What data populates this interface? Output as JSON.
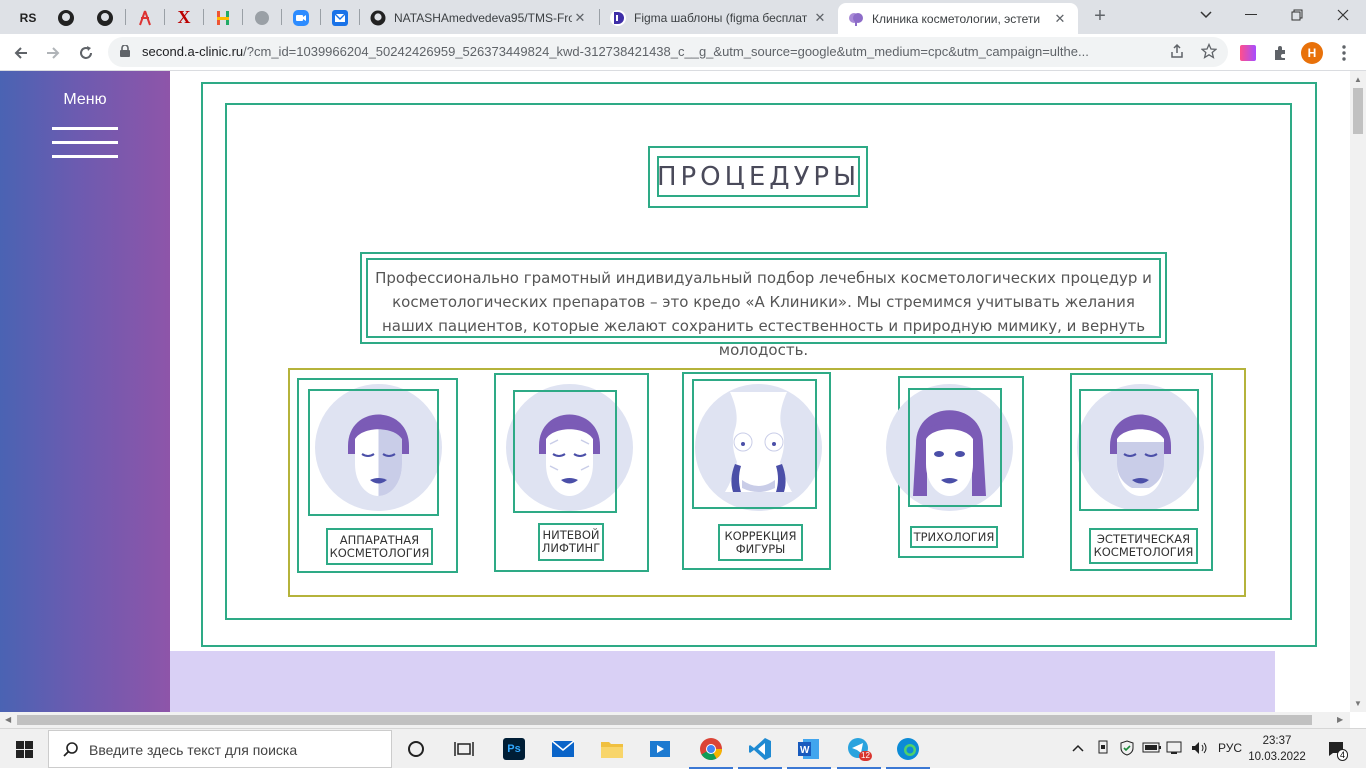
{
  "browser": {
    "pinned_tabs": [
      "RS",
      "github",
      "github",
      "ex",
      "X",
      "H",
      "globe",
      "zoom",
      "mail"
    ],
    "tabs": [
      {
        "title": "NATASHAmedvedeva95/TMS-Fro",
        "icon": "github-icon"
      },
      {
        "title": "Figma шаблоны (figma бесплат",
        "icon": "figma-d-icon"
      },
      {
        "title": "Клиника косметологии, эстети",
        "icon": "brain-icon",
        "active": true
      }
    ],
    "url_host": "second.a-clinic.ru",
    "url_rest": "/?cm_id=1039966204_50242426959_526373449824_kwd-312738421438_c__g_&utm_source=google&utm_medium=cpc&utm_campaign=ulthe...",
    "profile_initial": "H"
  },
  "sidebar": {
    "menu_label": "Меню"
  },
  "section": {
    "title": "ПРОЦЕДУРЫ",
    "description": "Профессионально грамотный индивидуальный подбор лечебных косметологических процедур и косметологических препаратов – это кредо «А Клиники». Мы стремимся учитывать желания наших пациентов, которые желают сохранить естественность и природную мимику, и вернуть молодость.",
    "procedures": [
      {
        "label_line1": "АППАРАТНАЯ",
        "label_line2": "КОСМЕТОЛОГИЯ",
        "icon": "hardware-cosmetology-face-icon"
      },
      {
        "label_line1": "НИТЕВОЙ",
        "label_line2": "ЛИФТИНГ",
        "icon": "thread-lifting-face-icon"
      },
      {
        "label_line1": "КОРРЕКЦИЯ",
        "label_line2": "ФИГУРЫ",
        "icon": "body-contouring-icon"
      },
      {
        "label_line1": "ТРИХОЛОГИЯ",
        "label_line2": "",
        "icon": "trichology-face-icon"
      },
      {
        "label_line1": "ЭСТЕТИЧЕСКАЯ",
        "label_line2": "КОСМЕТОЛОГИЯ",
        "icon": "aesthetic-cosmetology-face-icon"
      }
    ]
  },
  "colors": {
    "outline_green": "#2eaa86",
    "outline_olive": "#b5b33b",
    "hair_purple": "#7b5bb6",
    "lips_indigo": "#4b4fa8",
    "circle_bg": "#dfe3f2",
    "sidebar_from": "#4a63b3",
    "sidebar_to": "#8e55a9",
    "bottom_band": "#d9d0f5"
  },
  "taskbar": {
    "search_placeholder": "Введите здесь текст для поиска",
    "language": "РУС",
    "time": "23:37",
    "date": "10.03.2022",
    "notification_count": "4",
    "telegram_badge": "12"
  }
}
